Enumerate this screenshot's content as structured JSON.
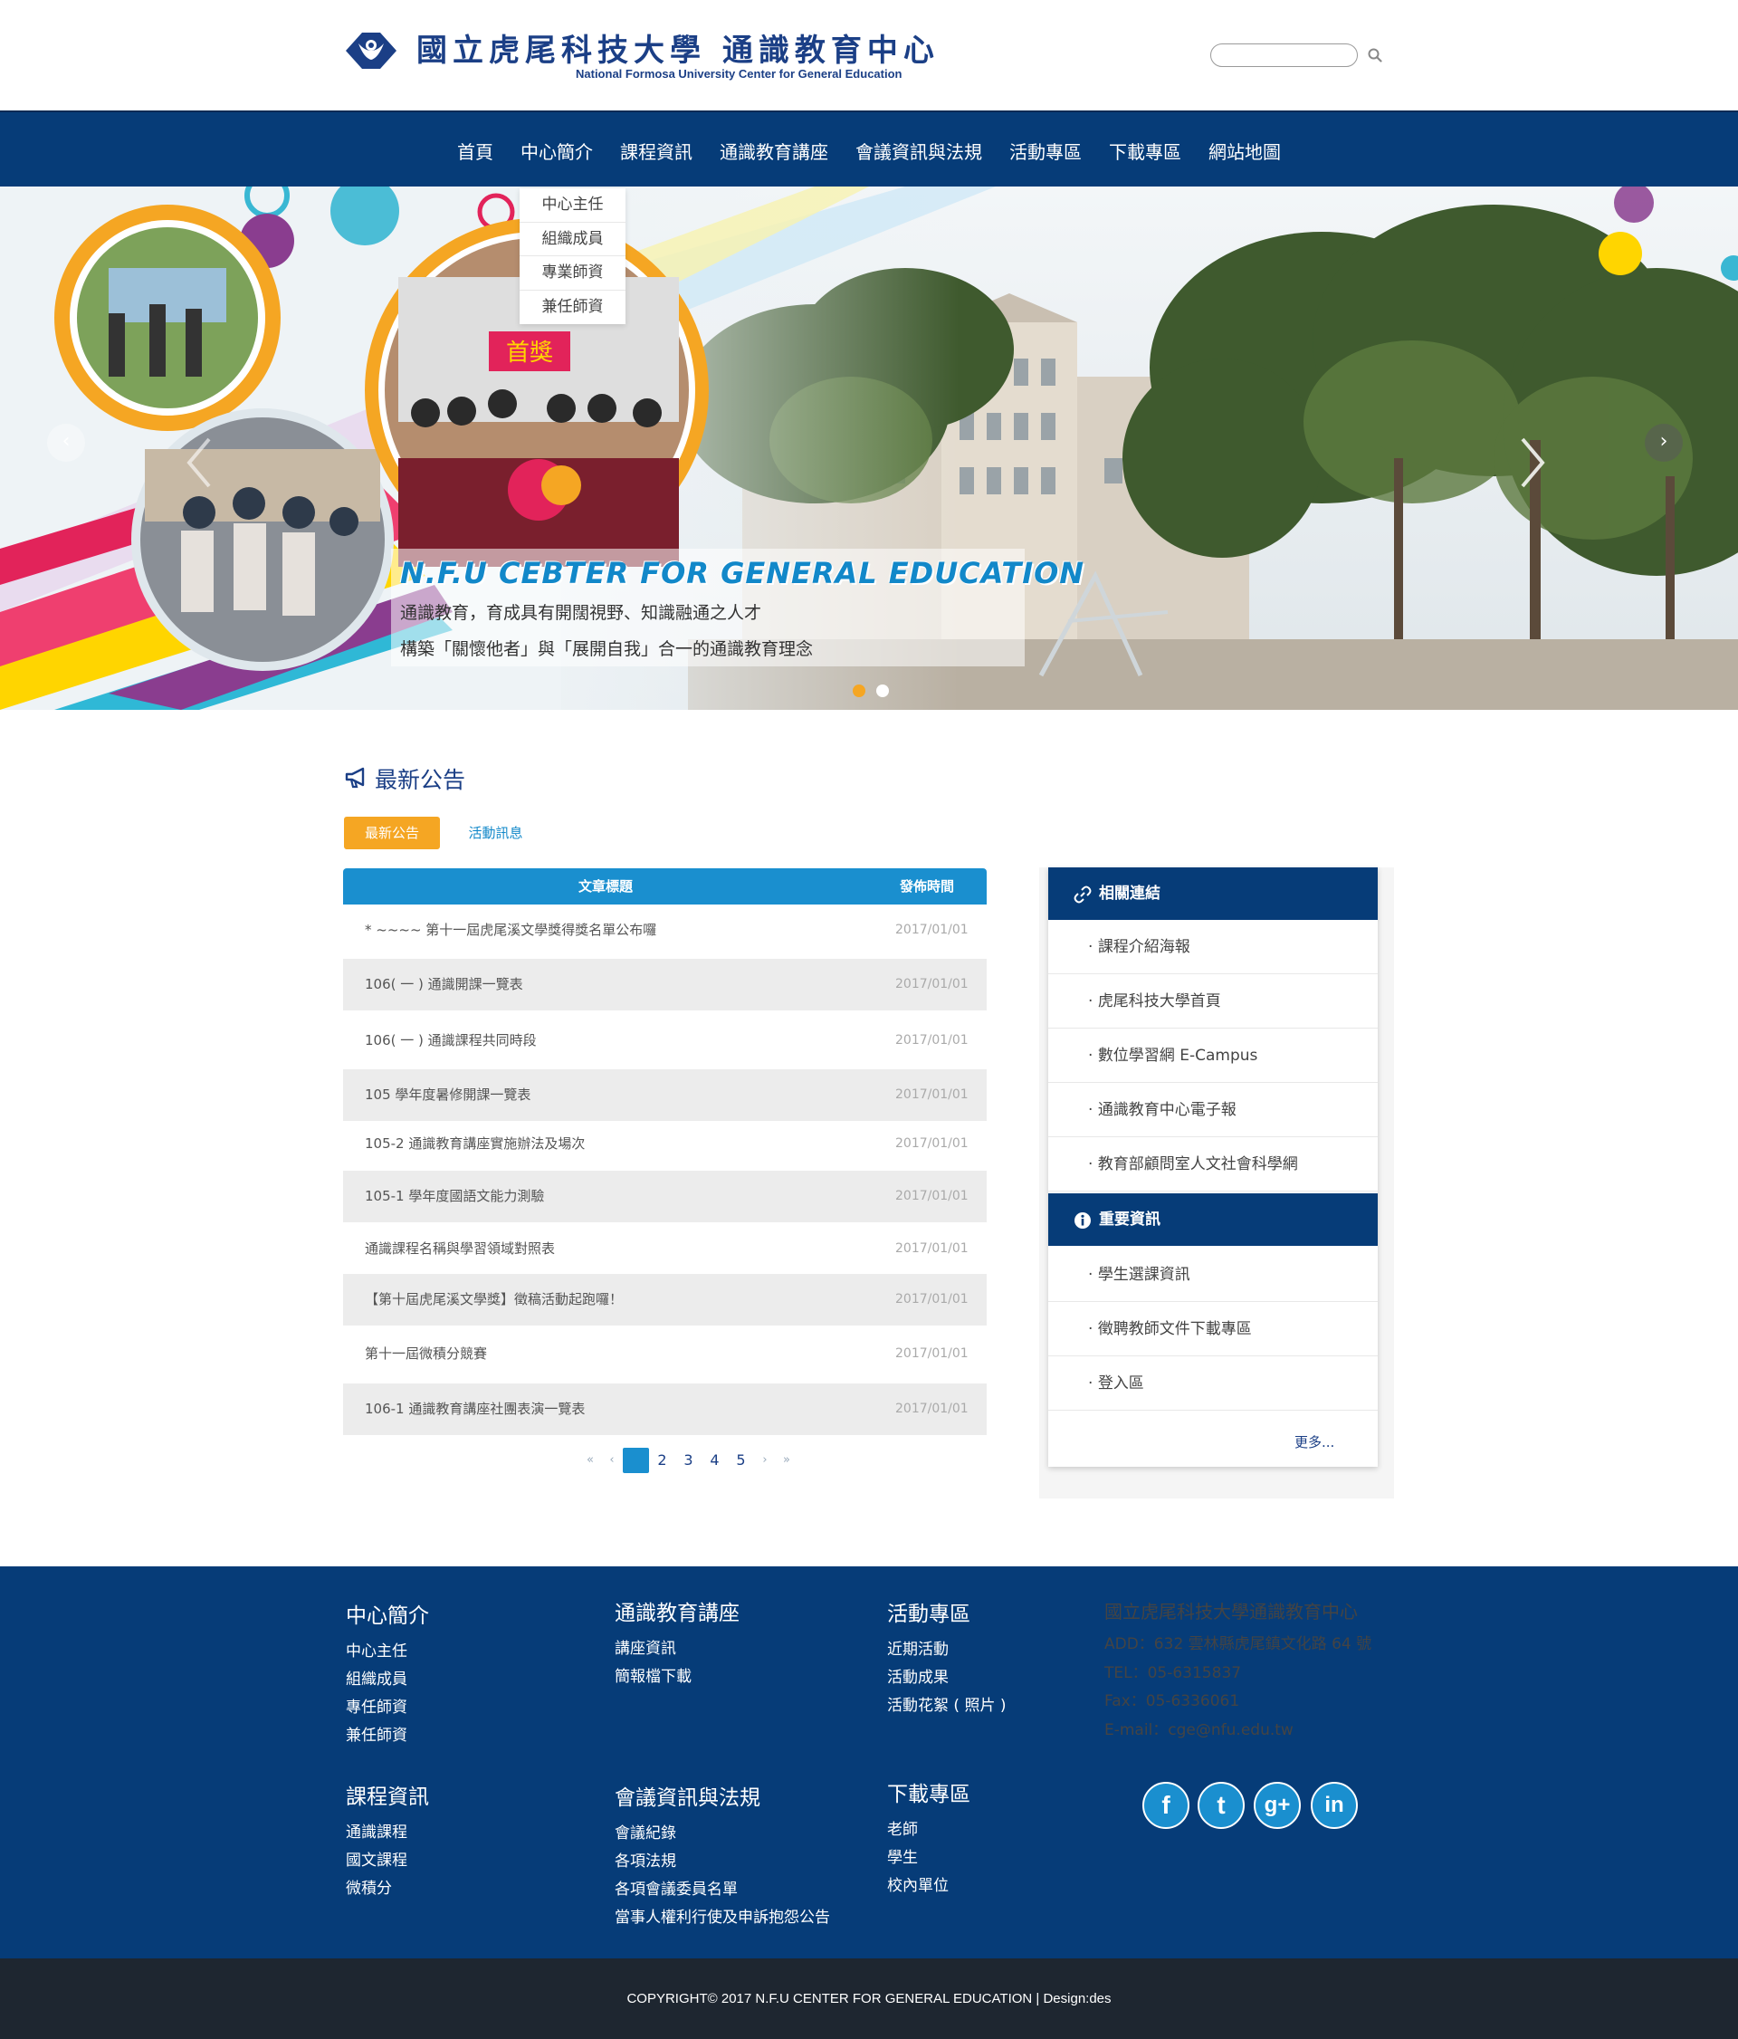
{
  "header": {
    "logo_cn": "國立虎尾科技大學 通識教育中心",
    "logo_en": "National Formosa University Center for General Education",
    "search_placeholder": "",
    "search_value": ""
  },
  "nav": {
    "items": [
      "首頁",
      "中心簡介",
      "課程資訊",
      "通識教育講座",
      "會議資訊與法規",
      "活動專區",
      "下載專區",
      "網站地圖"
    ]
  },
  "dropdown": {
    "items": [
      "中心主任",
      "組織成員",
      "專業師資",
      "兼任師資"
    ]
  },
  "hero": {
    "title": "N.F.U CEBTER FOR GENERAL EDUCATION",
    "line1": "通識教育，育成具有開闊視野、知識融通之人才",
    "line2": "構築「關懷他者」與「展開自我」合一的通識教育理念",
    "photo_text": "首獎",
    "arrow_left": "‹",
    "arrow_right": "›",
    "dot_count": 2,
    "active_dot": 0
  },
  "announcements": {
    "section_title": "最新公告",
    "tabs": [
      "最新公告",
      "活動訊息"
    ],
    "col_title": "文章標題",
    "col_date": "發佈時間",
    "rows": [
      {
        "title": "* ~~~~ 第十一屆虎尾溪文學獎得獎名單公布囉",
        "date": "2017/01/01"
      },
      {
        "title": "106( 一 ) 通識開課一覽表",
        "date": "2017/01/01"
      },
      {
        "title": "106( 一 ) 通識課程共同時段",
        "date": "2017/01/01"
      },
      {
        "title": "105 學年度暑修開課一覽表",
        "date": "2017/01/01"
      },
      {
        "title": "105-2 通識教育講座實施辦法及場次",
        "date": "2017/01/01"
      },
      {
        "title": "105-1 學年度國語文能力測驗",
        "date": "2017/01/01"
      },
      {
        "title": "通識課程名稱與學習領域對照表",
        "date": "2017/01/01"
      },
      {
        "title": "【第十屆虎尾溪文學獎】徵稿活動起跑囉！",
        "date": "2017/01/01"
      },
      {
        "title": "第十一屆微積分競賽",
        "date": "2017/01/01"
      },
      {
        "title": "106-1 通識教育講座社團表演一覽表",
        "date": "2017/01/01"
      }
    ],
    "pager": {
      "first": "«",
      "prev": "‹",
      "pages": [
        "1",
        "2",
        "3",
        "4",
        "5"
      ],
      "next": "›",
      "last": "»",
      "current": "1"
    }
  },
  "sidebar": {
    "links_title": "相關連結",
    "links": [
      "課程介紹海報",
      "虎尾科技大學首頁",
      "數位學習網 E-Campus",
      "通識教育中心電子報",
      "教育部顧問室人文社會科學網"
    ],
    "info_title": "重要資訊",
    "info": [
      "學生選課資訊",
      "徵聘教師文件下載專區",
      "登入區"
    ],
    "more": "更多..."
  },
  "footer": {
    "col1": {
      "title": "中心簡介",
      "links": [
        "中心主任",
        "組織成員",
        "專任師資",
        "兼任師資"
      ]
    },
    "col2": {
      "title": "通識教育講座",
      "links": [
        "講座資訊",
        "簡報檔下載"
      ]
    },
    "col3": {
      "title": "活動專區",
      "links": [
        "近期活動",
        "活動成果",
        "活動花絮 ( 照片 )"
      ]
    },
    "col4": {
      "title": "課程資訊",
      "links": [
        "通識課程",
        "國文課程",
        "微積分"
      ]
    },
    "col5": {
      "title": "會議資訊與法規",
      "links": [
        "會議紀錄",
        "各項法規",
        "各項會議委員名單",
        "當事人權利行使及申訴抱怨公告"
      ]
    },
    "col6": {
      "title": "下載專區",
      "links": [
        "老師",
        "學生",
        "校內單位"
      ]
    },
    "contact": {
      "title": "國立虎尾科技大學通識教育中心",
      "address": "ADD：632 雲林縣虎尾鎮文化路 64 號",
      "tel": "TEL：05-6315837",
      "fax": "Fax：05-6336061",
      "email": "E-mail：cge@nfu.edu.tw"
    },
    "social": [
      {
        "icon": "facebook-icon",
        "glyph": "f"
      },
      {
        "icon": "twitter-icon",
        "glyph": "t"
      },
      {
        "icon": "google-plus-icon",
        "glyph": "g+"
      },
      {
        "icon": "linkedin-icon",
        "glyph": "in"
      }
    ]
  },
  "copyright": "COPYRIGHT© 2017 N.F.U CENTER FOR GENERAL EDUCATION | Design:des",
  "colors": {
    "nav_blue": "#063c78",
    "accent_blue": "#1a8fcf",
    "tab_orange": "#f5a623",
    "copyright_bg": "#1e2630"
  }
}
